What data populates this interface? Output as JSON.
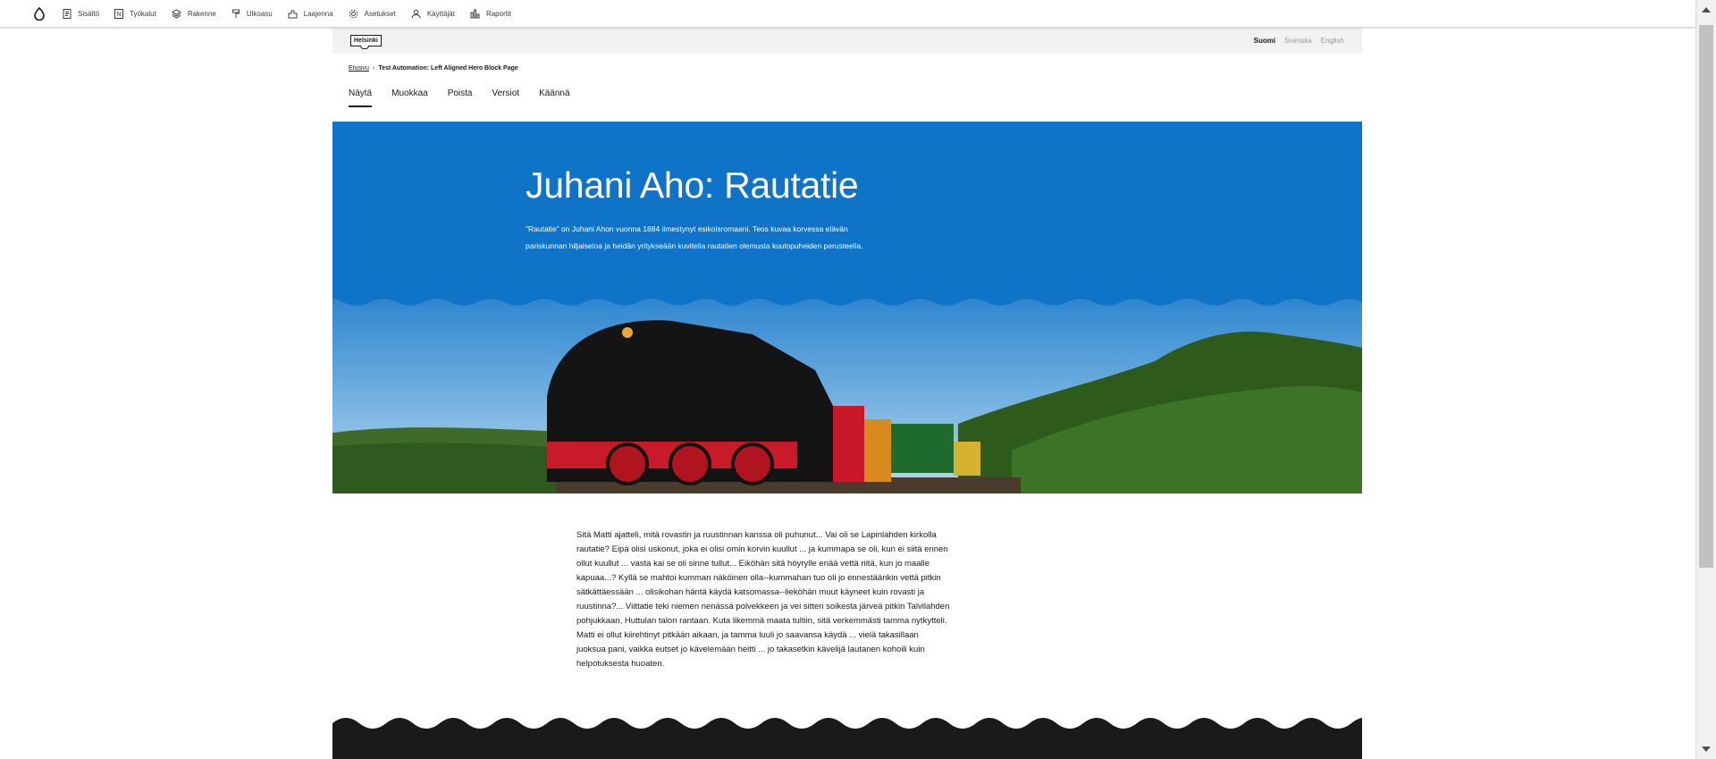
{
  "toolbar": {
    "items": [
      {
        "label": "Sisältö",
        "icon": "document-icon"
      },
      {
        "label": "Työkalut",
        "icon": "tools-icon"
      },
      {
        "label": "Rakenne",
        "icon": "structure-icon"
      },
      {
        "label": "Ulkoasu",
        "icon": "appearance-icon"
      },
      {
        "label": "Laajenna",
        "icon": "extend-icon"
      },
      {
        "label": "Asetukset",
        "icon": "gear-icon"
      },
      {
        "label": "Käyttäjät",
        "icon": "user-icon"
      },
      {
        "label": "Raportit",
        "icon": "reports-icon"
      }
    ]
  },
  "site": {
    "logo": "Helsinki",
    "languages": {
      "fi": "Suomi",
      "sv": "Svenska",
      "en": "English"
    }
  },
  "breadcrumb": {
    "home": "Etusivu",
    "current": "Test Automation: Left Aligned Hero Block Page"
  },
  "tabs": {
    "view": "Näytä",
    "edit": "Muokkaa",
    "delete": "Poista",
    "revisions": "Versiot",
    "translate": "Käännä"
  },
  "hero": {
    "title": "Juhani Aho: Rautatie",
    "description": "\"Rautatie\" on Juhani Ahon vuonna 1884 ilmestynyt esikoisromaani. Teos kuvaa korvessa elävän pariskunnan hiljaiseloa ja heidän yritykseään kuvitella rautatien olemusta kuulopuheiden perusteella."
  },
  "body_text": "Sitä Matti ajatteli, mitä rovastin ja ruustinnan kanssa oli puhunut... Vai oli se Lapinlahden kirkolla rautatie? Eipä olisi uskonut, joka ei olisi omin korvin kuullut ... ja kummapa se oli, kun ei siitä ennen ollut kuullut ... vasta kai se oli sinne tullut... Eiköhän sitä höyrylle enää vettä riitä, kun jo maalle kapuaa...? Kyllä se mahtoi kumman näköinen olla--kummahan tuo oli jo ennestäänkin vettä pitkin sätkättäessään ... olisikohan häntä käydä katsomassa--lieköhän muut käyneet kuin rovasti ja ruustinna?... Viittatie teki niemen nenässä polvekkeen ja vei sitten soikesta järveä pitkin Talvilahden pohjukkaan, Huttulan talon rantaan. Kuta likemmä maata tultiin, sitä verkemmästi tamma nytkytteli. Matti ei ollut kiirehtinyt pitkään aikaan, ja tamma luuli jo saavansa käydä ... vielä takasillaan juoksua pani, vaikka eutset jo kävelemään heitti ... jo takasetkin kävelijä lautanen kohoili kuin helpotuksesta huoaten.",
  "colors": {
    "hero_blue": "#0f73c8",
    "footer_black": "#1a1a1a",
    "header_gray": "#f2f2f2"
  }
}
